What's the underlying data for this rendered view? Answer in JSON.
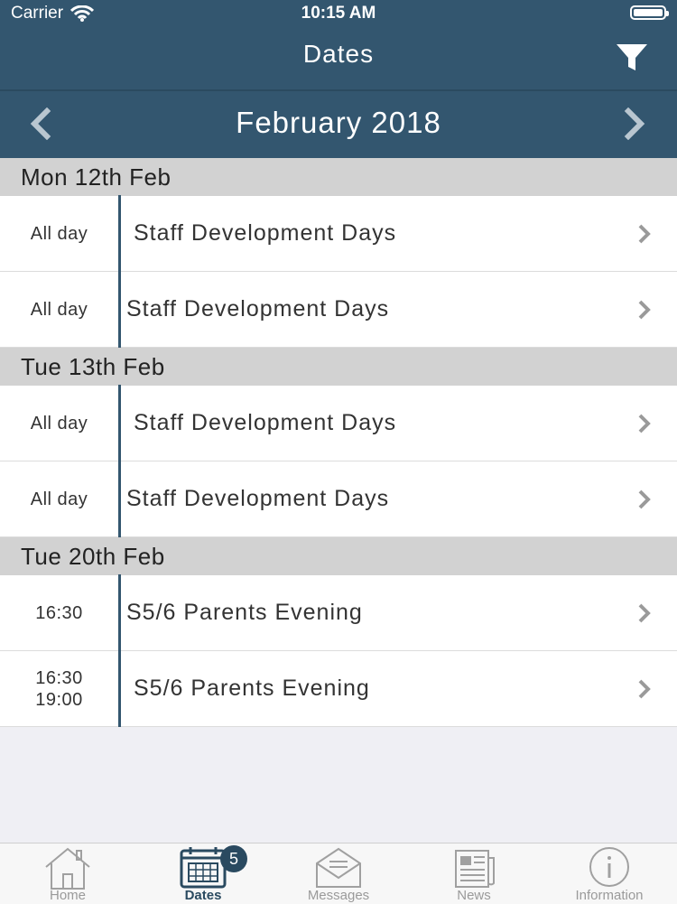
{
  "status": {
    "carrier": "Carrier",
    "time": "10:15 AM"
  },
  "nav": {
    "title": "Dates"
  },
  "month": {
    "label": "February 2018"
  },
  "sections": [
    {
      "header": "Mon 12th Feb",
      "rows": [
        {
          "time": "All day",
          "time2": "",
          "title": "Staff Development Days"
        },
        {
          "time": "All day",
          "time2": "",
          "title": "Staff Development Days"
        }
      ]
    },
    {
      "header": "Tue 13th Feb",
      "rows": [
        {
          "time": "All day",
          "time2": "",
          "title": "Staff Development Days"
        },
        {
          "time": "All day",
          "time2": "",
          "title": "Staff Development Days"
        }
      ]
    },
    {
      "header": "Tue 20th Feb",
      "rows": [
        {
          "time": "16:30",
          "time2": "",
          "title": "S5/6 Parents Evening"
        },
        {
          "time": "16:30",
          "time2": "19:00",
          "title": "S5/6 Parents Evening"
        }
      ]
    }
  ],
  "tabs": [
    {
      "label": "Home",
      "icon": "home-icon"
    },
    {
      "label": "Dates",
      "icon": "calendar-icon",
      "active": true
    },
    {
      "label": "Messages",
      "icon": "envelope-icon",
      "badge": "5"
    },
    {
      "label": "News",
      "icon": "newspaper-icon"
    },
    {
      "label": "Information",
      "icon": "info-icon"
    }
  ],
  "colors": {
    "primary": "#33566f",
    "section": "#d2d2d2",
    "background": "#efeff4"
  }
}
